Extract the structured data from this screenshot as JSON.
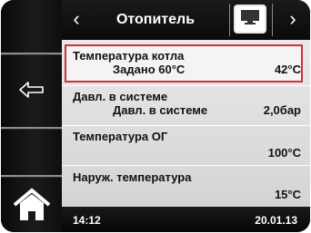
{
  "header": {
    "title": "Отопитель",
    "prev_icon": "chevron-left-icon",
    "next_icon": "chevron-right-icon",
    "screen_icon": "monitor-icon"
  },
  "sidebar": {
    "back_icon": "back-arrow-icon",
    "home_icon": "home-icon"
  },
  "rows": [
    {
      "label": "Температура котла",
      "sub": "Задано 60°C",
      "value": "42°C",
      "selected": true
    },
    {
      "label": "Давл. в системе",
      "sub": "Давл. в системе",
      "value": "2,0бар",
      "selected": false
    },
    {
      "label": "Температура ОГ",
      "sub": "",
      "value": "100°C",
      "selected": false
    },
    {
      "label": "Наруж. температура",
      "sub": "",
      "value": "15°C",
      "selected": false
    }
  ],
  "status": {
    "time": "14:12",
    "date": "20.01.13"
  },
  "colors": {
    "selection_border": "#d0303a",
    "background": "#0d0d0d",
    "content_bg": "#e0e0e0"
  }
}
